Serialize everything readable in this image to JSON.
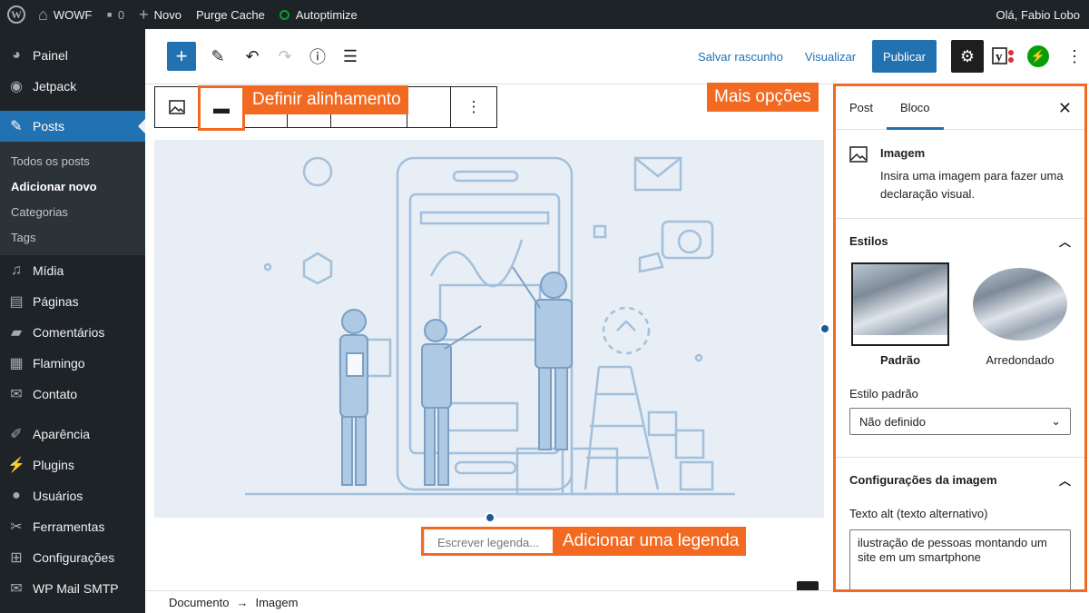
{
  "adminbar": {
    "site_name": "WOWF",
    "comments_count": "0",
    "new_label": "Novo",
    "purge_cache": "Purge Cache",
    "autoptimize": "Autoptimize",
    "greeting": "Olá, Fabio Lobo"
  },
  "sidebar": {
    "items": [
      {
        "label": "Painel",
        "icon": "dashboard-icon"
      },
      {
        "label": "Jetpack",
        "icon": "jetpack-icon"
      },
      {
        "label": "Posts",
        "icon": "pin-icon"
      },
      {
        "label": "Mídia",
        "icon": "media-icon"
      },
      {
        "label": "Páginas",
        "icon": "pages-icon"
      },
      {
        "label": "Comentários",
        "icon": "comments-icon"
      },
      {
        "label": "Flamingo",
        "icon": "flamingo-icon"
      },
      {
        "label": "Contato",
        "icon": "mail-icon"
      },
      {
        "label": "Aparência",
        "icon": "brush-icon"
      },
      {
        "label": "Plugins",
        "icon": "plugin-icon"
      },
      {
        "label": "Usuários",
        "icon": "users-icon"
      },
      {
        "label": "Ferramentas",
        "icon": "tools-icon"
      },
      {
        "label": "Configurações",
        "icon": "settings-icon"
      },
      {
        "label": "WP Mail SMTP",
        "icon": "mail-smtp-icon"
      }
    ],
    "posts_submenu": [
      "Todos os posts",
      "Adicionar novo",
      "Categorias",
      "Tags"
    ]
  },
  "header": {
    "save_draft": "Salvar rascunho",
    "preview": "Visualizar",
    "publish": "Publicar"
  },
  "canvas": {
    "caption_placeholder": "Escrever legenda..."
  },
  "footer": {
    "crumb_1": "Documento",
    "crumb_2": "Imagem"
  },
  "settings": {
    "tab_post": "Post",
    "tab_block": "Bloco",
    "block_title": "Imagem",
    "block_desc": "Insira uma imagem para fazer uma declaração visual.",
    "styles_heading": "Estilos",
    "style_default": "Padrão",
    "style_rounded": "Arredondado",
    "default_style_label": "Estilo padrão",
    "default_style_value": "Não definido",
    "image_settings_heading": "Configurações da imagem",
    "alt_label": "Texto alt (texto alternativo)",
    "alt_value": "ilustração de pessoas montando um site em um smartphone"
  },
  "callouts": {
    "align": "Definir alinhamento",
    "more": "Mais opções",
    "caption": "Adicionar uma legenda"
  },
  "colors": {
    "accent": "#2271b1",
    "callout": "#f26a21",
    "admin_bg": "#1d2327"
  }
}
